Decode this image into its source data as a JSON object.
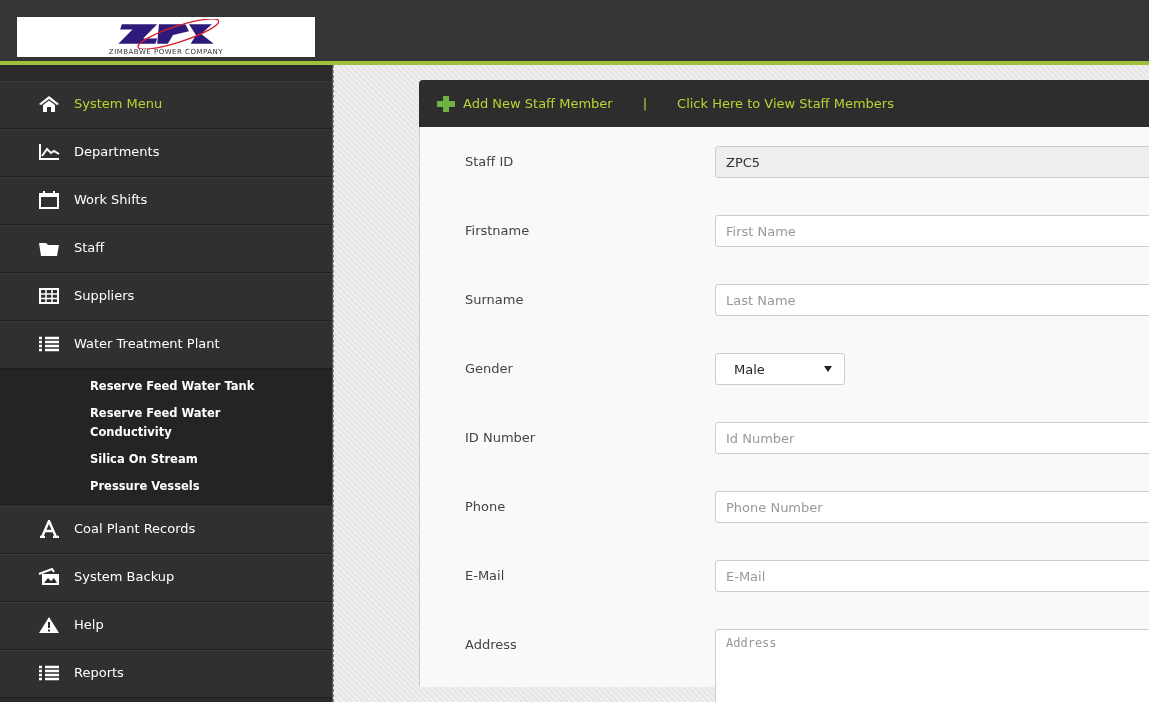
{
  "logo": {
    "caption": "ZIMBABWE POWER COMPANY"
  },
  "sidebar": {
    "items": [
      {
        "label": "System Menu",
        "kind": "home",
        "selected": true
      },
      {
        "label": "Departments",
        "kind": "chart",
        "selected": false
      },
      {
        "label": "Work Shifts",
        "kind": "calendar",
        "selected": false
      },
      {
        "label": "Staff",
        "kind": "folder",
        "selected": false
      },
      {
        "label": "Suppliers",
        "kind": "table",
        "selected": false
      },
      {
        "label": "Water Treatment Plant",
        "kind": "list",
        "selected": false,
        "children": [
          {
            "label": "Reserve Feed Water Tank"
          },
          {
            "label": "Reserve Feed Water Conductivity"
          },
          {
            "label": "Silica On Stream"
          },
          {
            "label": "Pressure Vessels"
          }
        ]
      },
      {
        "label": "Coal Plant Records",
        "kind": "letter",
        "selected": false
      },
      {
        "label": "System Backup",
        "kind": "pictures",
        "selected": false
      },
      {
        "label": "Help",
        "kind": "warning",
        "selected": false
      },
      {
        "label": "Reports",
        "kind": "list",
        "selected": false
      }
    ]
  },
  "toolbar": {
    "add_link": "Add New Staff Member",
    "separator": "|",
    "view_link": "Click Here to View Staff Members"
  },
  "form": {
    "fields": [
      {
        "label": "Staff ID",
        "kind": "text",
        "value": "ZPC5",
        "disabled": true
      },
      {
        "label": "Firstname",
        "kind": "text",
        "placeholder": "First Name",
        "disabled": false
      },
      {
        "label": "Surname",
        "kind": "text",
        "placeholder": "Last Name",
        "disabled": false
      },
      {
        "label": "Gender",
        "kind": "select",
        "value": "Male",
        "disabled": false
      },
      {
        "label": "ID Number",
        "kind": "text",
        "placeholder": "Id Number",
        "disabled": false
      },
      {
        "label": "Phone",
        "kind": "text",
        "placeholder": "Phone Number",
        "disabled": false
      },
      {
        "label": "E-Mail",
        "kind": "text",
        "placeholder": "E-Mail",
        "disabled": false
      },
      {
        "label": "Address",
        "kind": "textarea",
        "placeholder": "Address",
        "disabled": false
      }
    ]
  }
}
